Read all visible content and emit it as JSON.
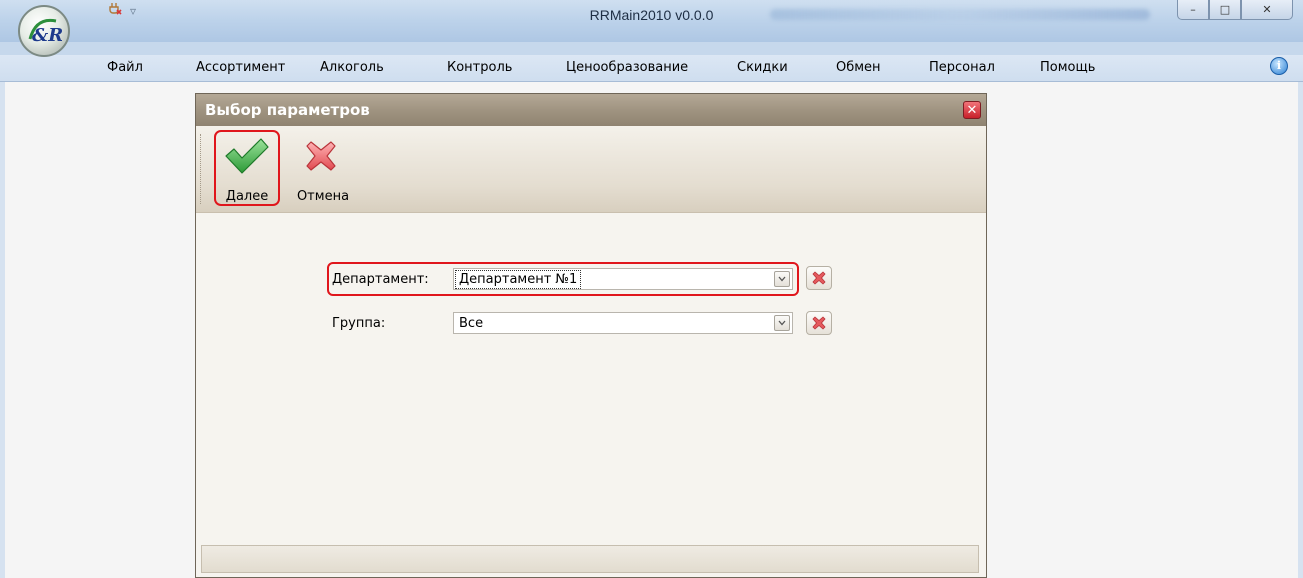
{
  "window": {
    "title": "RRMain2010 v0.0.0",
    "controls": {
      "minimize": "–",
      "maximize": "□",
      "close": "✕"
    }
  },
  "app_logo": {
    "text": "&R"
  },
  "quick_access": {
    "icon": "plug-icon",
    "dropdown": "▿"
  },
  "menu": {
    "items": [
      "Файл",
      "Ассортимент",
      "Алкоголь",
      "Контроль",
      "Ценообразование",
      "Скидки",
      "Обмен",
      "Персонал",
      "Помощь"
    ],
    "help_icon": "i"
  },
  "dialog": {
    "title": "Выбор параметров",
    "close": "✕",
    "toolbar": {
      "next_label": "Далее",
      "cancel_label": "Отмена"
    },
    "fields": [
      {
        "label": "Департамент:",
        "value": "Департамент №1"
      },
      {
        "label": "Группа:",
        "value": "Все"
      }
    ]
  },
  "colors": {
    "highlight": "#e0161c",
    "check": "#3aa83a",
    "cross": "#e55a5e"
  }
}
